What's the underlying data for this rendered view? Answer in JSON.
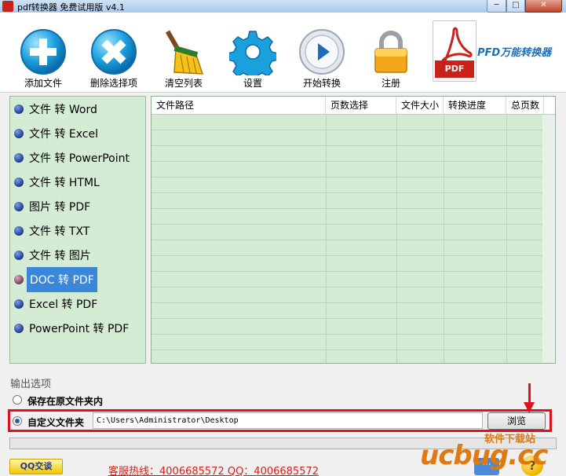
{
  "window": {
    "title": "pdf转换器 免费试用版 v4.1",
    "min_glyph": "─",
    "max_glyph": "□",
    "close_glyph": "✕"
  },
  "toolbar": {
    "items": [
      {
        "label": "添加文件",
        "icon": "add-icon"
      },
      {
        "label": "删除选择项",
        "icon": "delete-icon"
      },
      {
        "label": "清空列表",
        "icon": "broom-icon"
      },
      {
        "label": "设置",
        "icon": "gear-icon"
      },
      {
        "label": "开始转换",
        "icon": "play-icon"
      },
      {
        "label": "注册",
        "icon": "lock-icon"
      }
    ],
    "logo_text": "PFD万能转换器",
    "logo_badge": "PDF"
  },
  "menu": {
    "items": [
      "文件 转 Word",
      "文件 转 Excel",
      "文件 转 PowerPoint",
      "文件 转 HTML",
      "图片 转 PDF",
      "文件 转 TXT",
      "文件 转 图片",
      "DOC 转 PDF",
      "Excel 转 PDF",
      "PowerPoint 转 PDF"
    ],
    "selected_index": 7
  },
  "filelist": {
    "columns": [
      "文件路径",
      "页数选择",
      "文件大小",
      "转换进度",
      "总页数"
    ]
  },
  "output": {
    "title": "输出选项",
    "option_source": "保存在原文件夹内",
    "option_custom": "自定义文件夹",
    "selected": "custom",
    "path_value": "C:\\Users\\Administrator\\Desktop",
    "browse_label": "浏览"
  },
  "progress": {
    "value": 0
  },
  "footer": {
    "qq_label": "QQ交谈",
    "hotline": "客服热线：4006685572 QQ：4006685572",
    "help_glyph": "?",
    "chat_glyph": "···"
  },
  "watermark": {
    "main": "ucbug.cc",
    "sub": "软件下载站"
  },
  "colors": {
    "list_bg": "#d2ebd2",
    "selected_bg": "#3a86d8",
    "highlight": "#e0101e",
    "hotline": "#d8221b"
  }
}
